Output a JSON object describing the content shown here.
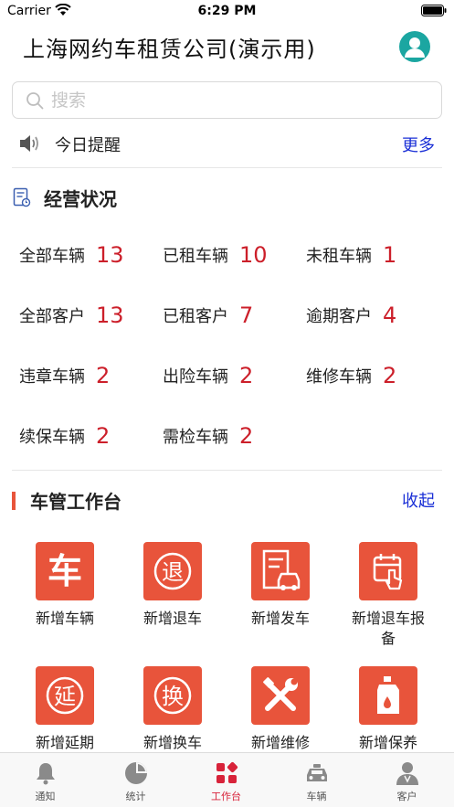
{
  "status_bar": {
    "carrier": "Carrier",
    "time": "6:29 PM"
  },
  "header": {
    "title": "上海网约车租赁公司(演示用)"
  },
  "search": {
    "placeholder": "搜索"
  },
  "notice": {
    "label": "今日提醒",
    "more": "更多"
  },
  "business": {
    "title": "经营状况",
    "stats": [
      {
        "label": "全部车辆",
        "value": "13"
      },
      {
        "label": "已租车辆",
        "value": "10"
      },
      {
        "label": "未租车辆",
        "value": "1"
      },
      {
        "label": "全部客户",
        "value": "13"
      },
      {
        "label": "已租客户",
        "value": "7"
      },
      {
        "label": "逾期客户",
        "value": "4"
      },
      {
        "label": "违章车辆",
        "value": "2"
      },
      {
        "label": "出险车辆",
        "value": "2"
      },
      {
        "label": "维修车辆",
        "value": "2"
      },
      {
        "label": "续保车辆",
        "value": "2"
      },
      {
        "label": "需检车辆",
        "value": "2"
      }
    ]
  },
  "workbench": {
    "title": "车管工作台",
    "collapse": "收起",
    "tiles": [
      {
        "label": "新增车辆",
        "glyph": "车",
        "icon": "car-char-icon"
      },
      {
        "label": "新增退车",
        "glyph": "退",
        "icon": "return-icon"
      },
      {
        "label": "新增发车",
        "icon": "dispatch-car-icon"
      },
      {
        "label": "新增退车报备",
        "icon": "calendar-tap-icon"
      },
      {
        "label": "新增延期",
        "glyph": "延",
        "icon": "extend-icon"
      },
      {
        "label": "新增换车",
        "glyph": "换",
        "icon": "swap-icon"
      },
      {
        "label": "新增维修",
        "icon": "tools-icon"
      },
      {
        "label": "新增保养",
        "icon": "oil-bottle-icon"
      }
    ]
  },
  "tabs": [
    {
      "label": "通知",
      "icon": "bell-icon"
    },
    {
      "label": "统计",
      "icon": "pie-chart-icon"
    },
    {
      "label": "工作台",
      "icon": "workbench-grid-icon",
      "active": true
    },
    {
      "label": "车辆",
      "icon": "taxi-icon"
    },
    {
      "label": "客户",
      "icon": "user-icon"
    }
  ],
  "colors": {
    "accent": "#e8543b",
    "link": "#1a2fd6",
    "value": "#cc1f2a",
    "avatar": "#1ba6a1",
    "active_tab": "#d8233a"
  }
}
